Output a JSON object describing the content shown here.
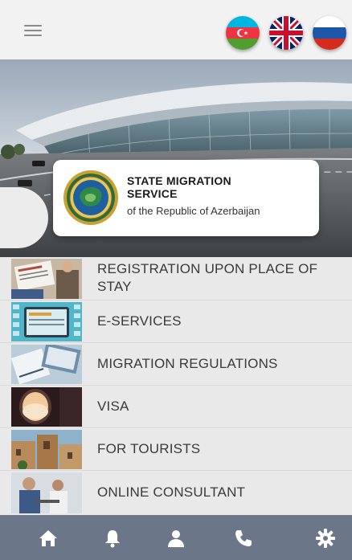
{
  "header": {
    "menu_icon": "hamburger-icon",
    "languages": [
      {
        "code": "az",
        "icon": "azerbaijan-flag-icon"
      },
      {
        "code": "en",
        "icon": "uk-flag-icon"
      },
      {
        "code": "ru",
        "icon": "russia-flag-icon"
      }
    ]
  },
  "hero": {
    "image": "airport-terminal-photo",
    "org_title_line1": "STATE MIGRATION",
    "org_title_line2": "SERVICE",
    "org_subtitle": "of the Republic of Azerbaijan",
    "emblem_icon": "state-migration-service-emblem"
  },
  "menu": [
    {
      "label_line1": "REGISTRATION UPON PLACE OF",
      "label_line2": "STAY",
      "thumb": "application-form-photo"
    },
    {
      "label_line1": "E-SERVICES",
      "label_line2": "",
      "thumb": "e-services-screen-photo"
    },
    {
      "label_line1": "MIGRATION REGULATIONS",
      "label_line2": "",
      "thumb": "documents-photo"
    },
    {
      "label_line1": "VISA",
      "label_line2": "",
      "thumb": "airplane-window-photo"
    },
    {
      "label_line1": "FOR TOURISTS",
      "label_line2": "",
      "thumb": "old-city-photo"
    },
    {
      "label_line1": "ONLINE CONSULTANT",
      "label_line2": "",
      "thumb": "office-people-photo"
    }
  ],
  "bottom_nav": [
    {
      "name": "home",
      "icon": "home-icon"
    },
    {
      "name": "notifications",
      "icon": "bell-icon"
    },
    {
      "name": "profile",
      "icon": "user-icon"
    },
    {
      "name": "contact",
      "icon": "phone-icon"
    },
    {
      "name": "settings",
      "icon": "gear-icon"
    }
  ],
  "colors": {
    "topbar_bg": "#f2f2f2",
    "menu_item_bg": "#e9e9e9",
    "menu_text": "#3a3a3a",
    "bottombar_bg": "#6c7689",
    "bottom_icon": "#ffffff"
  }
}
